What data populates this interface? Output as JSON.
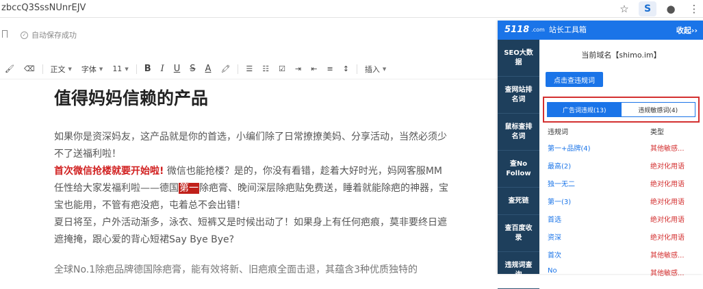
{
  "browser": {
    "url_fragment": "zbccQ3SssNUnrEJV",
    "icons": [
      "star-icon",
      "extension-s-icon",
      "account-icon",
      "more-icon"
    ]
  },
  "status": {
    "saved_text": "自动保存成功"
  },
  "toolbar": {
    "paragraph_label": "正文",
    "font_label": "字体",
    "size_label": "11",
    "bold": "B",
    "italic": "I",
    "underline": "U",
    "strike": "S",
    "font_color": "A",
    "insert_label": "插入"
  },
  "document": {
    "title": "值得妈妈信赖的产品",
    "p1": "如果你是资深妈友，这产品就是你的首选，小编们除了日常撩撩美妈、分享活动，当然必须少不了送福利啦！",
    "p2_red": "首次微信抢楼就要开始啦!",
    "p2_a": " 微信也能抢楼？是的，你没有看错，趁着大好时光，妈网客服MM任性给大家发福利啦——德国",
    "p2_highlight": "第一",
    "p2_b": "除疤膏、晚间深层除疤贴免费送，睡着就能除疤的神器，宝宝也能用，不管有疤没疤，屯着总不会出错！",
    "p3": "夏日将至，户外活动渐多，泳衣、短裤又是时候出动了！如果身上有任何疤痕，莫非要终日遮遮掩掩，跟心爱的背心短裙Say Bye Bye?",
    "p4": "全球No.1除疤品牌德国除疤膏，能有效将新、旧疤痕全面击退，其蕴含3种优质独特的"
  },
  "plugin": {
    "logo_mark": "5118",
    "logo_dotcom": ".com",
    "logo_text": "站长工具箱",
    "collapse_label": "收起››",
    "nav": [
      "SEO大数据",
      "查网站排名词",
      "鼠标查排名词",
      "查No Follow",
      "查死链",
      "查百度收录",
      "违规词查询"
    ],
    "domain_label": "当前域名【shimo.im】",
    "query_button": "点击查违规词",
    "tabs": [
      "广告词违规(13)",
      "违规敏感词(4)"
    ],
    "table_headers": [
      "违规词",
      "类型"
    ],
    "rows": [
      {
        "word": "第一+品牌(4)",
        "type": "其他敏感..."
      },
      {
        "word": "最高(2)",
        "type": "绝对化用语"
      },
      {
        "word": "独一无二",
        "type": "绝对化用语"
      },
      {
        "word": "第一(3)",
        "type": "绝对化用语"
      },
      {
        "word": "首选",
        "type": "绝对化用语"
      },
      {
        "word": "资深",
        "type": "绝对化用语"
      },
      {
        "word": "首次",
        "type": "其他敏感..."
      },
      {
        "word": "No",
        "type": "其他敏感..."
      }
    ]
  },
  "colors": {
    "plugin_blue": "#1a74e8",
    "nav_dark": "#1e3f5c",
    "alert_red": "#d32f2f",
    "highlight_red": "#c0201a"
  }
}
